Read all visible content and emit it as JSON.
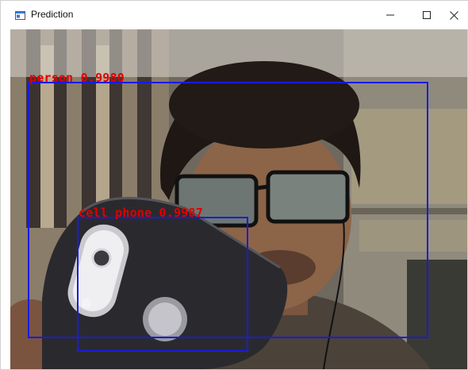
{
  "window": {
    "title": "Prediction",
    "icon": "app-window-icon",
    "controls": {
      "minimize_icon": "minimize-icon",
      "maximize_icon": "maximize-icon",
      "close_icon": "close-icon"
    }
  },
  "detections": [
    {
      "label": "person 0.9980",
      "class": "person",
      "score": 0.998
    },
    {
      "label": "cell phone 0.9987",
      "class": "cell phone",
      "score": 0.9987
    }
  ],
  "colors": {
    "box": "#1a1ae6",
    "label_text": "#e00000"
  }
}
